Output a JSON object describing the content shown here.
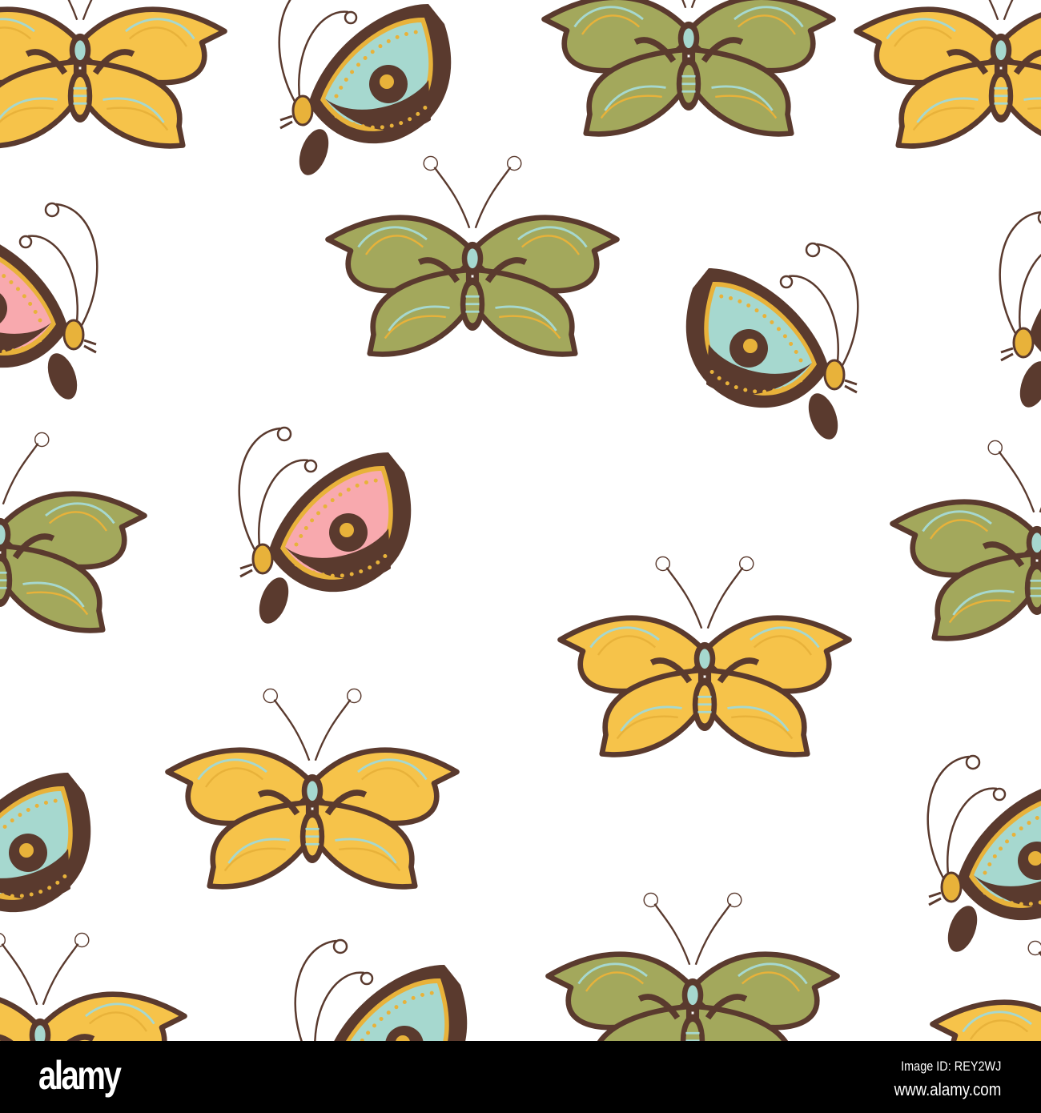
{
  "image": {
    "colors": {
      "background": "#ffffff",
      "outline": "#5a3a2e",
      "green": "#a3a85c",
      "yellow": "#f6c34a",
      "teal": "#a6d8cf",
      "pink": "#f8a9ae",
      "accent": "#e8b23a"
    }
  },
  "watermark": {
    "logo": "alamy",
    "image_id": "Image ID: REY2WJ",
    "site": "www.alamy.com"
  }
}
